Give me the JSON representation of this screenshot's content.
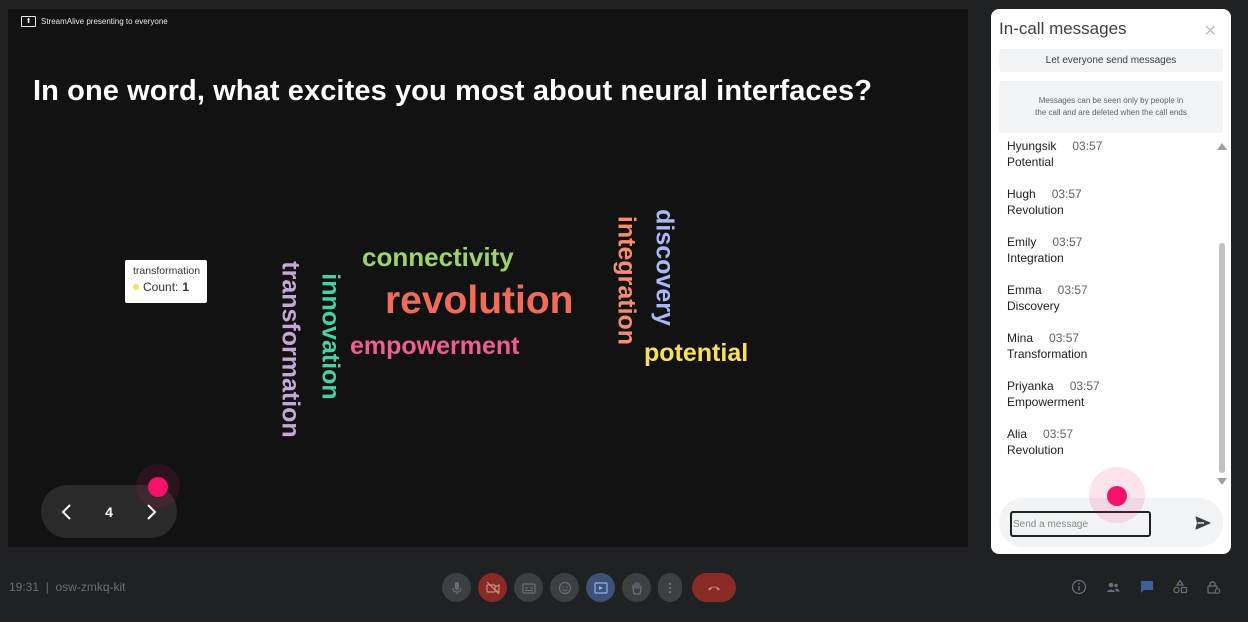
{
  "presenting": {
    "label": "StreamAlive presenting to everyone",
    "icon": "present-screen-icon"
  },
  "slide": {
    "question": "In one word, what excites you most about neural interfaces?",
    "words": [
      {
        "text": "connectivity",
        "color": "#9cd36b"
      },
      {
        "text": "revolution",
        "color": "#f36b59"
      },
      {
        "text": "empowerment",
        "color": "#f15d8c"
      },
      {
        "text": "potential",
        "color": "#fde05a"
      },
      {
        "text": "transformation",
        "color": "#c7a6d8"
      },
      {
        "text": "innovation",
        "color": "#47d2a6"
      },
      {
        "text": "integration",
        "color": "#f78e6d"
      },
      {
        "text": "discovery",
        "color": "#a9b9f5"
      }
    ],
    "tooltip": {
      "title": "transformation",
      "count_label": "Count:",
      "count_value": "1"
    },
    "pager": {
      "page": "4",
      "prev_icon": "chevron-left-icon",
      "next_icon": "chevron-right-icon"
    }
  },
  "panel": {
    "title": "In-call messages",
    "close_icon": "close-icon",
    "toggle_label": "Let everyone send messages",
    "notice": "Messages can be seen only by people in the call and are deleted when the call ends",
    "messages": [
      {
        "sender": "Hyungsik",
        "time": "03:57",
        "text": "Potential"
      },
      {
        "sender": "Hugh",
        "time": "03:57",
        "text": "Revolution"
      },
      {
        "sender": "Emily",
        "time": "03:57",
        "text": "Integration"
      },
      {
        "sender": "Emma",
        "time": "03:57",
        "text": "Discovery"
      },
      {
        "sender": "Mina",
        "time": "03:57",
        "text": "Transformation"
      },
      {
        "sender": "Priyanka",
        "time": "03:57",
        "text": "Empowerment"
      },
      {
        "sender": "Alia",
        "time": "03:57",
        "text": "Revolution"
      }
    ],
    "composer": {
      "placeholder": "Send a message",
      "send_icon": "send-icon"
    }
  },
  "toolbar": {
    "meeting_info": "19:31  |  osw-zmkq-kit",
    "controls": [
      "mic-icon",
      "camera-off-icon",
      "captions-icon",
      "emoji-icon",
      "present-icon",
      "raise-hand-icon",
      "more-options-icon",
      "end-call-icon"
    ],
    "right_icons": [
      "info-icon",
      "people-icon",
      "chat-icon",
      "activities-icon",
      "lock-icon"
    ],
    "colors": {
      "danger": "#ea4335",
      "active": "#8ab4f8",
      "neutral": "#3c4043"
    }
  },
  "accent": "#f5126b"
}
